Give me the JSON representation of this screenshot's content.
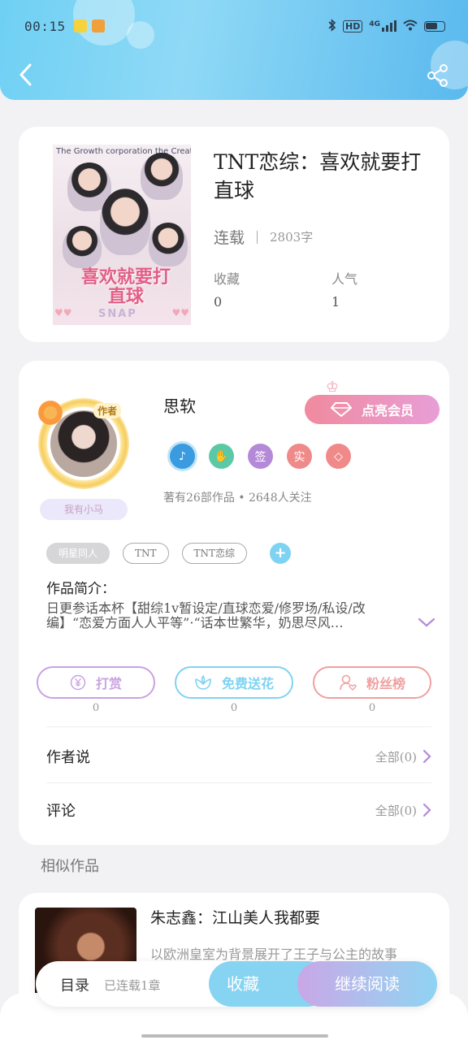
{
  "status_bar": {
    "time": "00:15",
    "network": "4G"
  },
  "book": {
    "title": "TNT恋综：喜欢就要打直球",
    "status": "连载",
    "word_count": "2803字",
    "stats": [
      {
        "label": "收藏",
        "value": "0"
      },
      {
        "label": "人气",
        "value": "1"
      }
    ],
    "cover": {
      "top_text": "The Growth corporation the Creator",
      "title": "喜欢就要打直球",
      "brand": "SNAP"
    }
  },
  "author": {
    "name": "思软",
    "role_badge": "作者",
    "nickname": "我有小马",
    "vip_button": "点亮会员",
    "badges": [
      {
        "icon": "music-note-icon",
        "label": "",
        "color": "#3a9be0"
      },
      {
        "icon": "handshake-icon",
        "label": "",
        "color": "#5bc9a8"
      },
      {
        "icon": "sign-icon",
        "label": "签",
        "color": "#b48ad8"
      },
      {
        "icon": "verified-icon",
        "label": "实",
        "color": "#ef8a8a"
      },
      {
        "icon": "diamond-icon",
        "label": "",
        "color": "#f08a8a"
      }
    ],
    "stats": "著有26部作品 • 2648人关注"
  },
  "tags": [
    "明星同人",
    "TNT",
    "TNT恋综"
  ],
  "intro": {
    "label": "作品简介：",
    "text": "日更参话本杯【甜综1v暂设定/直球恋爱/修罗场/私设/改编】“恋爱方面人人平等”·“话本世繁华，奶思尽风…"
  },
  "actions": [
    {
      "icon": "yen-icon",
      "label": "打赏",
      "count": "0",
      "color": "#c9a2e0"
    },
    {
      "icon": "flower-icon",
      "label": "免费送花",
      "count": "0",
      "color": "#7fd3f2"
    },
    {
      "icon": "fans-icon",
      "label": "粉丝榜",
      "count": "0",
      "color": "#f0a0a0"
    }
  ],
  "author_says": {
    "title": "作者说",
    "more": "全部(0)"
  },
  "comments": {
    "title": "评论",
    "more": "全部(0)"
  },
  "similar": {
    "section_title": "相似作品",
    "items": [
      {
        "title": "朱志鑫：江山美人我都要",
        "desc": "以欧洲皇室为背景展开了王子与公主的故事"
      }
    ]
  },
  "bottom_bar": {
    "toc": "目录",
    "status": "已连载1章",
    "favorite": "收藏",
    "continue": "继续阅读"
  }
}
